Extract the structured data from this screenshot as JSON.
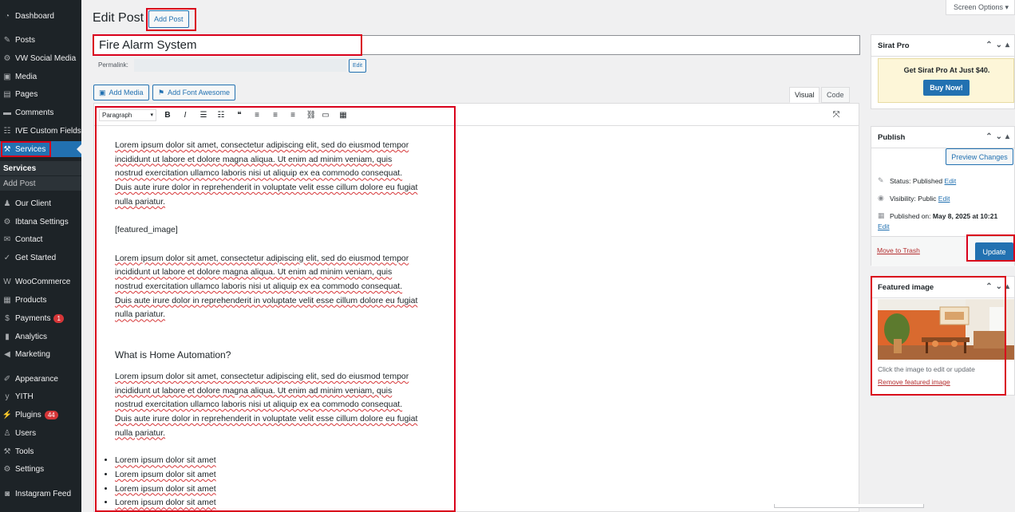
{
  "sidebar": {
    "items": [
      {
        "label": "Dashboard",
        "icon": "dashboard-icon",
        "glyph": "◔"
      },
      {
        "label": "Posts",
        "icon": "pin-icon",
        "glyph": "✎"
      },
      {
        "label": "VW Social Media",
        "icon": "gear-icon",
        "glyph": "⚙"
      },
      {
        "label": "Media",
        "icon": "media-icon",
        "glyph": "▣"
      },
      {
        "label": "Pages",
        "icon": "pages-icon",
        "glyph": "▤"
      },
      {
        "label": "Comments",
        "icon": "comment-icon",
        "glyph": "▬"
      },
      {
        "label": "IVE Custom Fields",
        "icon": "fields-icon",
        "glyph": "☷"
      },
      {
        "label": "Services",
        "icon": "wrench-icon",
        "glyph": "⚒"
      },
      {
        "label": "Our Client",
        "icon": "users-icon",
        "glyph": "♟"
      },
      {
        "label": "Ibtana Settings",
        "icon": "settings-icon",
        "glyph": "⚙"
      },
      {
        "label": "Contact",
        "icon": "mail-icon",
        "glyph": "✉"
      },
      {
        "label": "Get Started",
        "icon": "check-icon",
        "glyph": "✓"
      },
      {
        "label": "WooCommerce",
        "icon": "woocommerce-icon",
        "glyph": "W"
      },
      {
        "label": "Products",
        "icon": "archive-icon",
        "glyph": "▦"
      },
      {
        "label": "Payments",
        "icon": "dollar-icon",
        "glyph": "$",
        "badge": "1"
      },
      {
        "label": "Analytics",
        "icon": "bar-chart-icon",
        "glyph": "▮"
      },
      {
        "label": "Marketing",
        "icon": "megaphone-icon",
        "glyph": "◀"
      },
      {
        "label": "Appearance",
        "icon": "brush-icon",
        "glyph": "✐"
      },
      {
        "label": "YITH",
        "icon": "yith-icon",
        "glyph": "y"
      },
      {
        "label": "Plugins",
        "icon": "plugin-icon",
        "glyph": "⚡",
        "badge": "44"
      },
      {
        "label": "Users",
        "icon": "user-icon",
        "glyph": "♙"
      },
      {
        "label": "Tools",
        "icon": "tools-icon",
        "glyph": "⚒"
      },
      {
        "label": "Settings",
        "icon": "settings-icon",
        "glyph": "⚙"
      },
      {
        "label": "Instagram Feed",
        "icon": "instagram-icon",
        "glyph": "◙"
      }
    ],
    "submenu": [
      {
        "label": "Services"
      },
      {
        "label": "Add Post"
      }
    ]
  },
  "header": {
    "title": "Edit Post",
    "add_post_label": "Add Post",
    "screen_options_label": "Screen Options ▾"
  },
  "post": {
    "title": "Fire Alarm System",
    "permalink_label": "Permalink:",
    "permalink_edit_label": "Edit"
  },
  "media_buttons": {
    "add_media": "Add Media",
    "add_font_awesome": "Add Font Awesome"
  },
  "editor_tabs": {
    "visual": "Visual",
    "code": "Code"
  },
  "toolbar": {
    "format_value": "Paragraph",
    "buttons": [
      {
        "name": "bold-icon",
        "glyph": "B"
      },
      {
        "name": "italic-icon",
        "glyph": "I"
      },
      {
        "name": "bullet-list-icon",
        "glyph": "☰"
      },
      {
        "name": "numbered-list-icon",
        "glyph": "☷"
      },
      {
        "name": "blockquote-icon",
        "glyph": "❝"
      },
      {
        "name": "align-left-icon",
        "glyph": "≡"
      },
      {
        "name": "align-center-icon",
        "glyph": "≡"
      },
      {
        "name": "align-right-icon",
        "glyph": "≡"
      },
      {
        "name": "link-icon",
        "glyph": "⛓"
      },
      {
        "name": "read-more-icon",
        "glyph": "▭"
      },
      {
        "name": "toolbar-toggle-icon",
        "glyph": "▦"
      }
    ],
    "fullscreen_glyph": "⤧"
  },
  "content": {
    "para1_lines": [
      "Lorem ipsum dolor sit amet, consectetur adipiscing elit, sed do eiusmod tempor",
      "incididunt ut labore et dolore magna aliqua. Ut enim ad minim veniam, quis",
      "nostrud exercitation ullamco laboris nisi ut aliquip ex ea commodo consequat.",
      "Duis aute irure dolor in reprehenderit in voluptate velit esse cillum dolore eu fugiat",
      "nulla pariatur."
    ],
    "shortcode": "[featured_image]",
    "para2_lines": [
      "Lorem ipsum dolor sit amet, consectetur adipiscing elit, sed do eiusmod tempor",
      "incididunt ut labore et dolore magna aliqua. Ut enim ad minim veniam, quis",
      "nostrud exercitation ullamco laboris nisi ut aliquip ex ea commodo consequat.",
      "Duis aute irure dolor in reprehenderit in voluptate velit esse cillum dolore eu fugiat",
      "nulla pariatur."
    ],
    "heading": "What is Home Automation?",
    "para3_lines": [
      "Lorem ipsum dolor sit amet, consectetur adipiscing elit, sed do eiusmod tempor",
      "incididunt ut labore et dolore magna aliqua. Ut enim ad minim veniam, quis",
      "nostrud exercitation ullamco laboris nisi ut aliquip ex ea commodo consequat.",
      "Duis aute irure dolor in reprehenderit in voluptate velit esse cillum dolore eu fugiat",
      "nulla pariatur."
    ],
    "list_items": [
      "Lorem ipsum dolor sit amet",
      "Lorem ipsum dolor sit amet",
      "Lorem ipsum dolor sit amet",
      "Lorem ipsum dolor sit amet"
    ]
  },
  "sirat_box": {
    "title": "Sirat Pro",
    "promo_text": "Get Sirat Pro At Just $40.",
    "buy_label": "Buy Now!"
  },
  "publish_box": {
    "title": "Publish",
    "preview_label": "Preview Changes",
    "status_label": "Status: Published",
    "visibility_label": "Visibility: Public",
    "published_on_prefix": "Published on:",
    "published_on_date": "May 8, 2025 at 10:21",
    "edit_label": "Edit",
    "trash_label": "Move to Trash",
    "update_label": "Update"
  },
  "featured_box": {
    "title": "Featured image",
    "caption": "Click the image to edit or update",
    "remove_label": "Remove featured image"
  },
  "colors": {
    "accent": "#2271b1",
    "sidebar_bg": "#1d2327",
    "highlight_red": "#d9001b"
  }
}
